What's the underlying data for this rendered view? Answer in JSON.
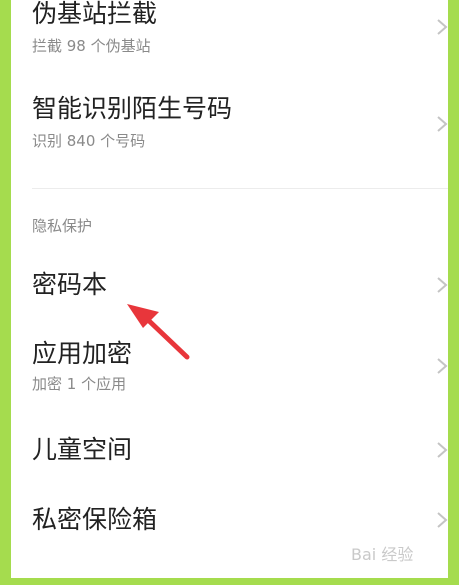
{
  "settings_items": [
    {
      "title": "伪基站拦截",
      "subtitle": "拦截 98 个伪基站"
    },
    {
      "title": "智能识别陌生号码",
      "subtitle": "识别 840 个号码"
    },
    {
      "title": "密码本",
      "subtitle": ""
    },
    {
      "title": "应用加密",
      "subtitle": "加密 1 个应用"
    },
    {
      "title": "儿童空间",
      "subtitle": ""
    },
    {
      "title": "私密保险箱",
      "subtitle": ""
    }
  ],
  "section_header": "隐私保护",
  "watermark": "Bai 经验",
  "annotation_arrow_color": "#e8363b",
  "frame_color": "#a5dc4e"
}
